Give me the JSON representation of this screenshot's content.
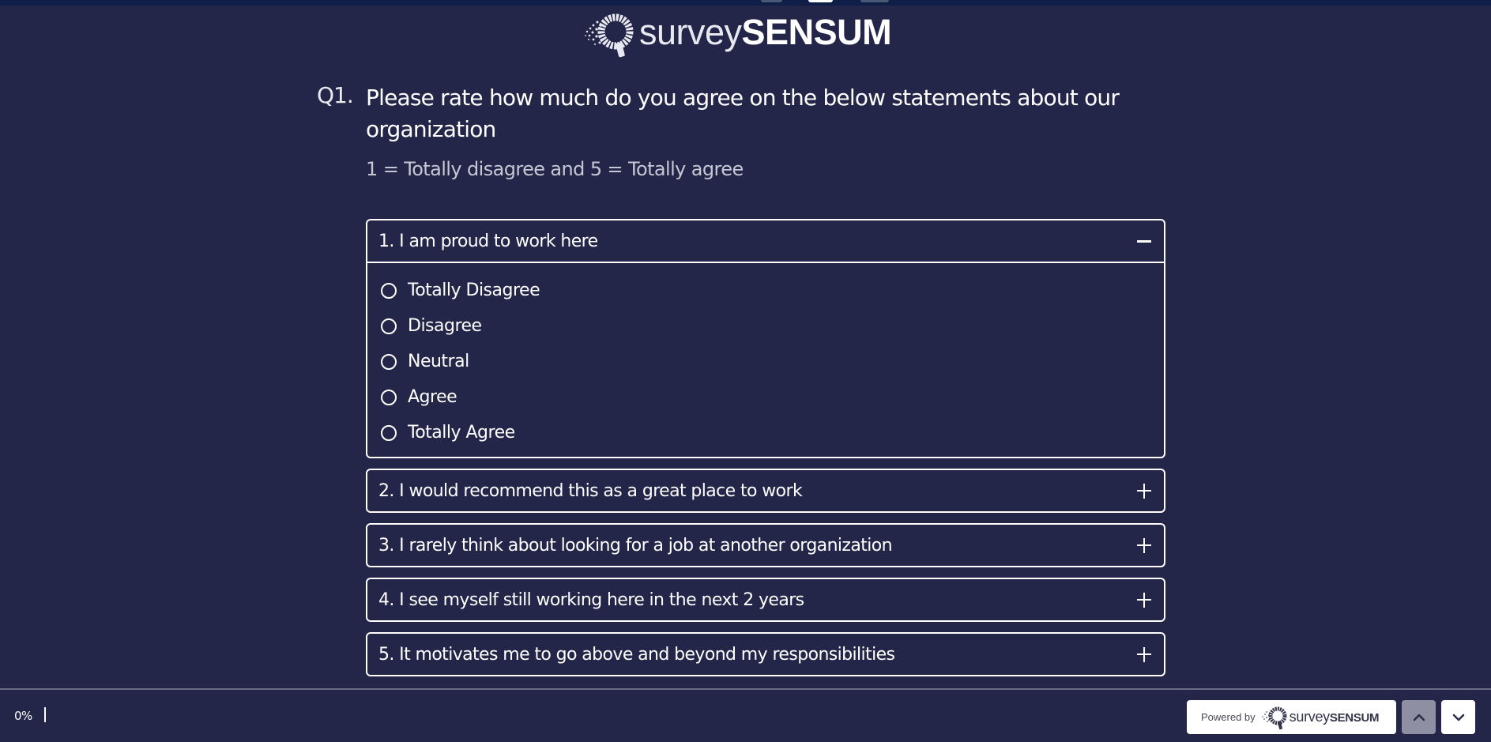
{
  "brand": {
    "logo_light": "survey",
    "logo_bold": "SENSUM"
  },
  "question": {
    "number": "Q1.",
    "title": "Please rate how much do you agree on the below statements about our organization",
    "subtitle": "1 = Totally disagree and 5 = Totally agree"
  },
  "statements": [
    {
      "label": "1. I am proud to work here",
      "expanded": true,
      "toggle_icon": "minus-icon",
      "options": [
        "Totally Disagree",
        "Disagree",
        "Neutral",
        "Agree",
        "Totally Agree"
      ]
    },
    {
      "label": "2. I would recommend this as a great place to work",
      "expanded": false,
      "toggle_icon": "plus-icon"
    },
    {
      "label": "3. I rarely think about looking for a job at another organization",
      "expanded": false,
      "toggle_icon": "plus-icon"
    },
    {
      "label": "4. I see myself still working here in the next 2 years",
      "expanded": false,
      "toggle_icon": "plus-icon"
    },
    {
      "label": "5. It motivates me to go above and beyond my responsibilities",
      "expanded": false,
      "toggle_icon": "plus-icon"
    }
  ],
  "footer": {
    "progress_text": "0%",
    "progress_value": 0,
    "powered_by": "Powered by",
    "powered_light": "survey",
    "powered_bold": "SENSUM",
    "prev_icon": "chevron-up-icon",
    "next_icon": "chevron-down-icon"
  },
  "colors": {
    "background": "#242649",
    "topbar": "#0f1e46",
    "text": "#ffffff",
    "subtext": "#c6c7d3",
    "nav_disabled": "#8e8fa2"
  }
}
